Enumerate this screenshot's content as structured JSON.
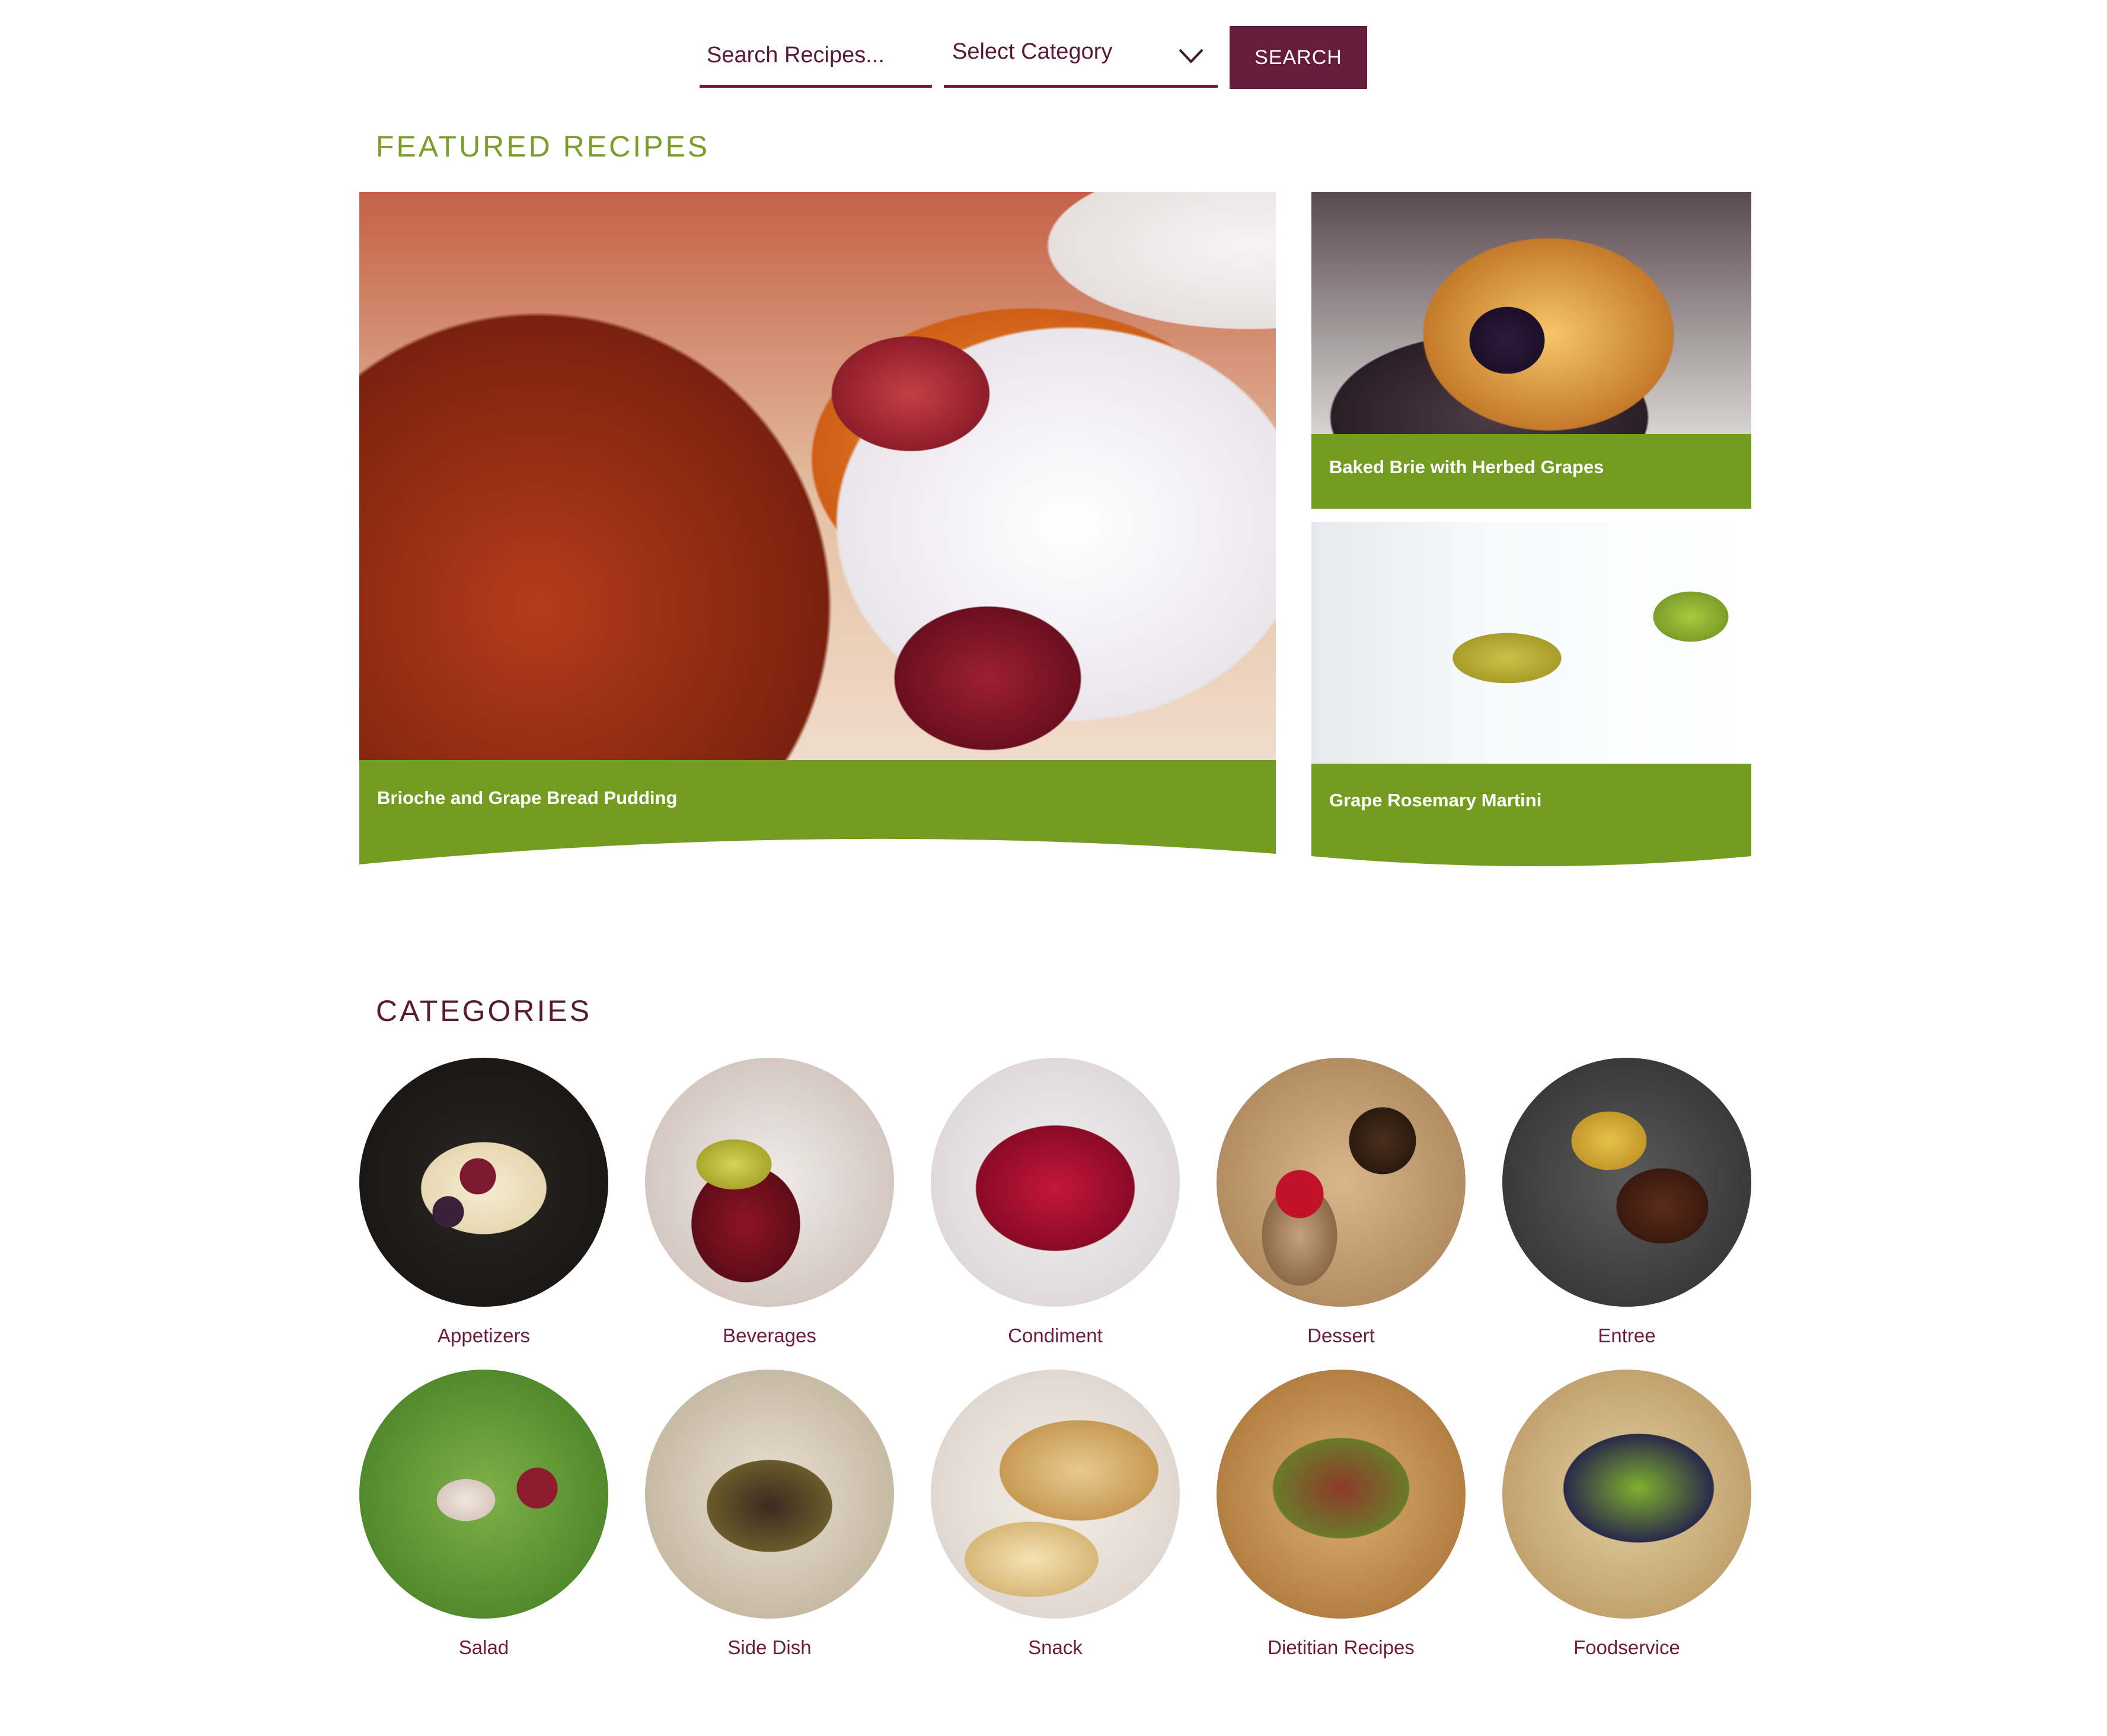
{
  "search": {
    "placeholder": "Search Recipes...",
    "category_label": "Select Category",
    "button_label": "SEARCH"
  },
  "featured": {
    "title": "FEATURED RECIPES",
    "cards": [
      {
        "caption": "Brioche and Grape Bread Pudding"
      },
      {
        "caption": "Baked Brie with Herbed Grapes"
      },
      {
        "caption": "Grape Rosemary Martini"
      }
    ]
  },
  "categories": {
    "title": "CATEGORIES",
    "items": [
      {
        "label": "Appetizers"
      },
      {
        "label": "Beverages"
      },
      {
        "label": "Condiment"
      },
      {
        "label": "Dessert"
      },
      {
        "label": "Entree"
      },
      {
        "label": "Salad"
      },
      {
        "label": "Side Dish"
      },
      {
        "label": "Snack"
      },
      {
        "label": "Dietitian Recipes"
      },
      {
        "label": "Foodservice"
      }
    ]
  },
  "colors": {
    "brand_plum": "#661c3c",
    "brand_green": "#7b9e2a",
    "caption_green": "#749c21"
  },
  "icons": {
    "dropdown": "chevron-down-icon"
  }
}
